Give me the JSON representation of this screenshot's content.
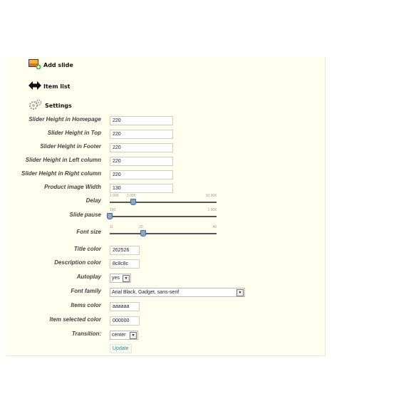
{
  "menu": {
    "add_slide": "Add slide",
    "item_list": "Item list",
    "settings": "Settings"
  },
  "fields": {
    "slider_height_homepage": {
      "label": "Slider Height in Homepage",
      "value": "220"
    },
    "slider_height_top": {
      "label": "Slider Height in Top",
      "value": "220"
    },
    "slider_height_footer": {
      "label": "Slider Height in Footer",
      "value": "220"
    },
    "slider_height_left": {
      "label": "Slider Height in Left column",
      "value": "220"
    },
    "slider_height_right": {
      "label": "Slider Height in Right column",
      "value": "220"
    },
    "product_image_width": {
      "label": "Product image Width",
      "value": "130"
    },
    "delay": {
      "label": "Delay",
      "min": "1 000",
      "value_label": "3 000",
      "max": "10 000",
      "value": 3000,
      "fraction": 0.222
    },
    "slide_pause": {
      "label": "Slide pause",
      "min": "100",
      "max": "1 000",
      "value": 100,
      "fraction": 0.0
    },
    "font_size": {
      "label": "Font size",
      "min": "11",
      "value_label": "20",
      "max": "40",
      "value": 20,
      "fraction": 0.31
    },
    "title_color": {
      "label": "Title color",
      "value": "262526"
    },
    "description_color": {
      "label": "Description color",
      "value": "8c8c8c"
    },
    "autoplay": {
      "label": "Autoplay",
      "value": "yes"
    },
    "font_family": {
      "label": "Font family",
      "value": "Arial Black, Gadget, sans-serif"
    },
    "items_color": {
      "label": "Items color",
      "value": "aaaaaa"
    },
    "item_selected_color": {
      "label": "Item selected color",
      "value": "000000"
    },
    "transition": {
      "label": "Transition:",
      "value": "center"
    }
  },
  "update_label": "Update",
  "colors": {
    "panel_bg": "#fffff0",
    "button_text": "#3a8a8a"
  }
}
